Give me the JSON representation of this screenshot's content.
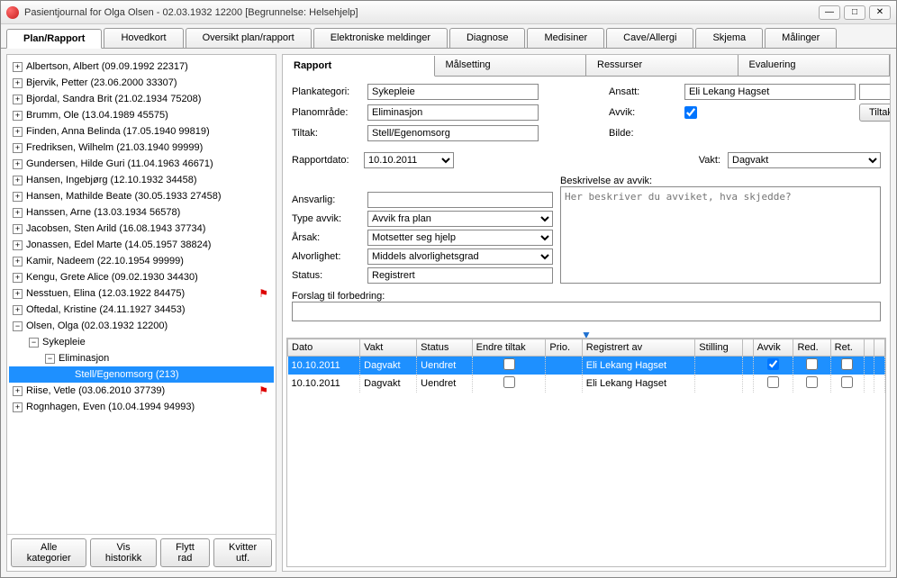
{
  "window": {
    "title": "Pasientjournal for Olga Olsen - 02.03.1932 12200   [Begrunnelse: Helsehjelp]"
  },
  "mainTabs": [
    "Plan/Rapport",
    "Hovedkort",
    "Oversikt plan/rapport",
    "Elektroniske meldinger",
    "Diagnose",
    "Medisiner",
    "Cave/Allergi",
    "Skjema",
    "Målinger"
  ],
  "tree": [
    {
      "t": "Albertson, Albert (09.09.1992 22317)",
      "lv": 0,
      "exp": "+"
    },
    {
      "t": "Bjervik, Petter (23.06.2000 33307)",
      "lv": 0,
      "exp": "+"
    },
    {
      "t": "Bjordal, Sandra Brit (21.02.1934 75208)",
      "lv": 0,
      "exp": "+"
    },
    {
      "t": "Brumm, Ole (13.04.1989 45575)",
      "lv": 0,
      "exp": "+"
    },
    {
      "t": "Finden, Anna Belinda (17.05.1940 99819)",
      "lv": 0,
      "exp": "+"
    },
    {
      "t": "Fredriksen, Wilhelm (21.03.1940 99999)",
      "lv": 0,
      "exp": "+"
    },
    {
      "t": "Gundersen, Hilde Guri (11.04.1963 46671)",
      "lv": 0,
      "exp": "+"
    },
    {
      "t": "Hansen, Ingebjørg (12.10.1932 34458)",
      "lv": 0,
      "exp": "+"
    },
    {
      "t": "Hansen, Mathilde Beate (30.05.1933 27458)",
      "lv": 0,
      "exp": "+"
    },
    {
      "t": "Hanssen, Arne (13.03.1934 56578)",
      "lv": 0,
      "exp": "+"
    },
    {
      "t": "Jacobsen, Sten Arild (16.08.1943 37734)",
      "lv": 0,
      "exp": "+"
    },
    {
      "t": "Jonassen, Edel Marte (14.05.1957 38824)",
      "lv": 0,
      "exp": "+"
    },
    {
      "t": "Kamir, Nadeem (22.10.1954 99999)",
      "lv": 0,
      "exp": "+"
    },
    {
      "t": "Kengu, Grete Alice (09.02.1930 34430)",
      "lv": 0,
      "exp": "+"
    },
    {
      "t": "Nesstuen, Elina (12.03.1922 84475)",
      "lv": 0,
      "exp": "+",
      "flag": true
    },
    {
      "t": "Oftedal, Kristine (24.11.1927 34453)",
      "lv": 0,
      "exp": "+"
    },
    {
      "t": "Olsen, Olga (02.03.1932 12200)",
      "lv": 0,
      "exp": "−"
    },
    {
      "t": "Sykepleie",
      "lv": 1,
      "exp": "−"
    },
    {
      "t": "Eliminasjon",
      "lv": 2,
      "exp": "−"
    },
    {
      "t": "Stell/Egenomsorg (213)",
      "lv": 3,
      "exp": "",
      "sel": true
    },
    {
      "t": "Riise, Vetle (03.06.2010 37739)",
      "lv": 0,
      "exp": "+",
      "flag": true
    },
    {
      "t": "Rognhagen, Even (10.04.1994 94993)",
      "lv": 0,
      "exp": "+"
    }
  ],
  "leftButtons": {
    "all": "Alle kategorier",
    "hist": "Vis historikk",
    "move": "Flytt rad",
    "kvitt": "Kvitter utf."
  },
  "subTabs": [
    "Rapport",
    "Målsetting",
    "Ressurser",
    "Evaluering"
  ],
  "form": {
    "plankat_lbl": "Plankategori:",
    "plankat": "Sykepleie",
    "planomr_lbl": "Planområde:",
    "planomr": "Eliminasjon",
    "tiltak_lbl": "Tiltak:",
    "tiltak": "Stell/Egenomsorg",
    "ansatt_lbl": "Ansatt:",
    "ansatt": "Eli Lekang Hagset",
    "avvik_lbl": "Avvik:",
    "avvik": true,
    "bilde_lbl": "Bilde:",
    "tiltakbtn": "Tiltaksbeskrivelse",
    "rapdato_lbl": "Rapportdato:",
    "rapdato": "10.10.2011",
    "vakt_lbl": "Vakt:",
    "vakt": "Dagvakt",
    "ansvarlig_lbl": "Ansvarlig:",
    "ansvarlig": "",
    "typeavvik_lbl": "Type avvik:",
    "typeavvik": "Avvik fra plan",
    "arsak_lbl": "Årsak:",
    "arsak": "Motsetter seg hjelp",
    "alvor_lbl": "Alvorlighet:",
    "alvor": "Middels alvorlighetsgrad",
    "status_lbl": "Status:",
    "status": "Registrert",
    "beskriv_lbl": "Beskrivelse av avvik:",
    "beskriv_ph": "Her beskriver du avviket, hva skjedde?",
    "forslag_lbl": "Forslag til forbedring:"
  },
  "grid": {
    "cols": [
      "Dato",
      "Vakt",
      "Status",
      "Endre tiltak",
      "Prio.",
      "Registrert av",
      "Stilling",
      "",
      "Avvik",
      "Red.",
      "Ret.",
      "",
      ""
    ],
    "rows": [
      {
        "dato": "10.10.2011",
        "vakt": "Dagvakt",
        "status": "Uendret",
        "endre": false,
        "prio": "",
        "reg": "Eli Lekang Hagset",
        "stilling": "",
        "avvik": true,
        "red": false,
        "ret": false,
        "sel": true
      },
      {
        "dato": "10.10.2011",
        "vakt": "Dagvakt",
        "status": "Uendret",
        "endre": false,
        "prio": "",
        "reg": "Eli Lekang Hagset",
        "stilling": "",
        "avvik": false,
        "red": false,
        "ret": false,
        "sel": false
      }
    ]
  }
}
